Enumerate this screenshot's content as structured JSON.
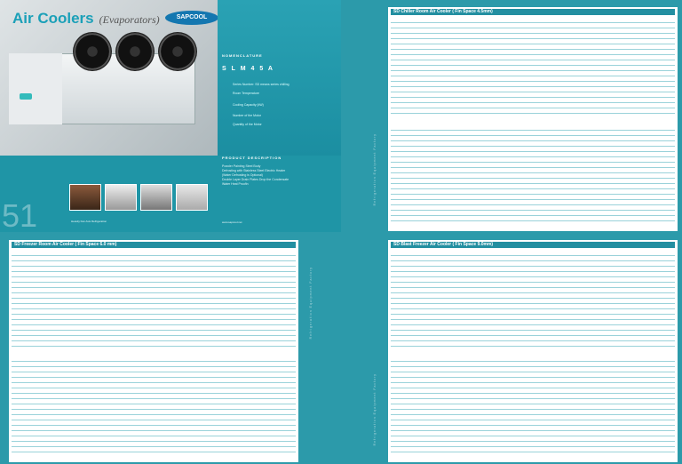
{
  "cover": {
    "title": "Air Coolers",
    "subtitle": "(Evaporators)",
    "logo": "SAPCOOL",
    "nomenclature_title": "NOMENCLATURE",
    "nomenclature_code": "S L M 4 5 A",
    "nomenclature_lines": [
      "Series Number: SD means series chilling",
      "Room Temperature",
      "Cooling Capacity (kW)",
      "Number of the Motor",
      "Quantity of the Motor"
    ],
    "product_title": "PRODUCT DESCRIPTION",
    "product_lines": [
      "Powder Painting Steel Body",
      "Defrosting with Stainless Steel Electric Heater",
      "(Water Defrosting is Optional)",
      "Double Layer Drain Plates Drop the Condensate",
      "Water Heat Proofin"
    ],
    "page_number": "51",
    "footer": "Heavily Fan Axis Refrigeration",
    "url": "www.sapcool.net"
  },
  "sheets": {
    "chiller": {
      "title": "SD Chiller Room Air Cooler ( Fin Space 4.5mm)"
    },
    "freezer": {
      "title": "SD Freezer Room Air Cooler ( Fin Space 6.0 mm)"
    },
    "blast": {
      "title": "SD Blast Freezer Air Cooler ( Fin Space 9.0mm)"
    }
  },
  "side_text": "Refrigeration Equipment Factory"
}
